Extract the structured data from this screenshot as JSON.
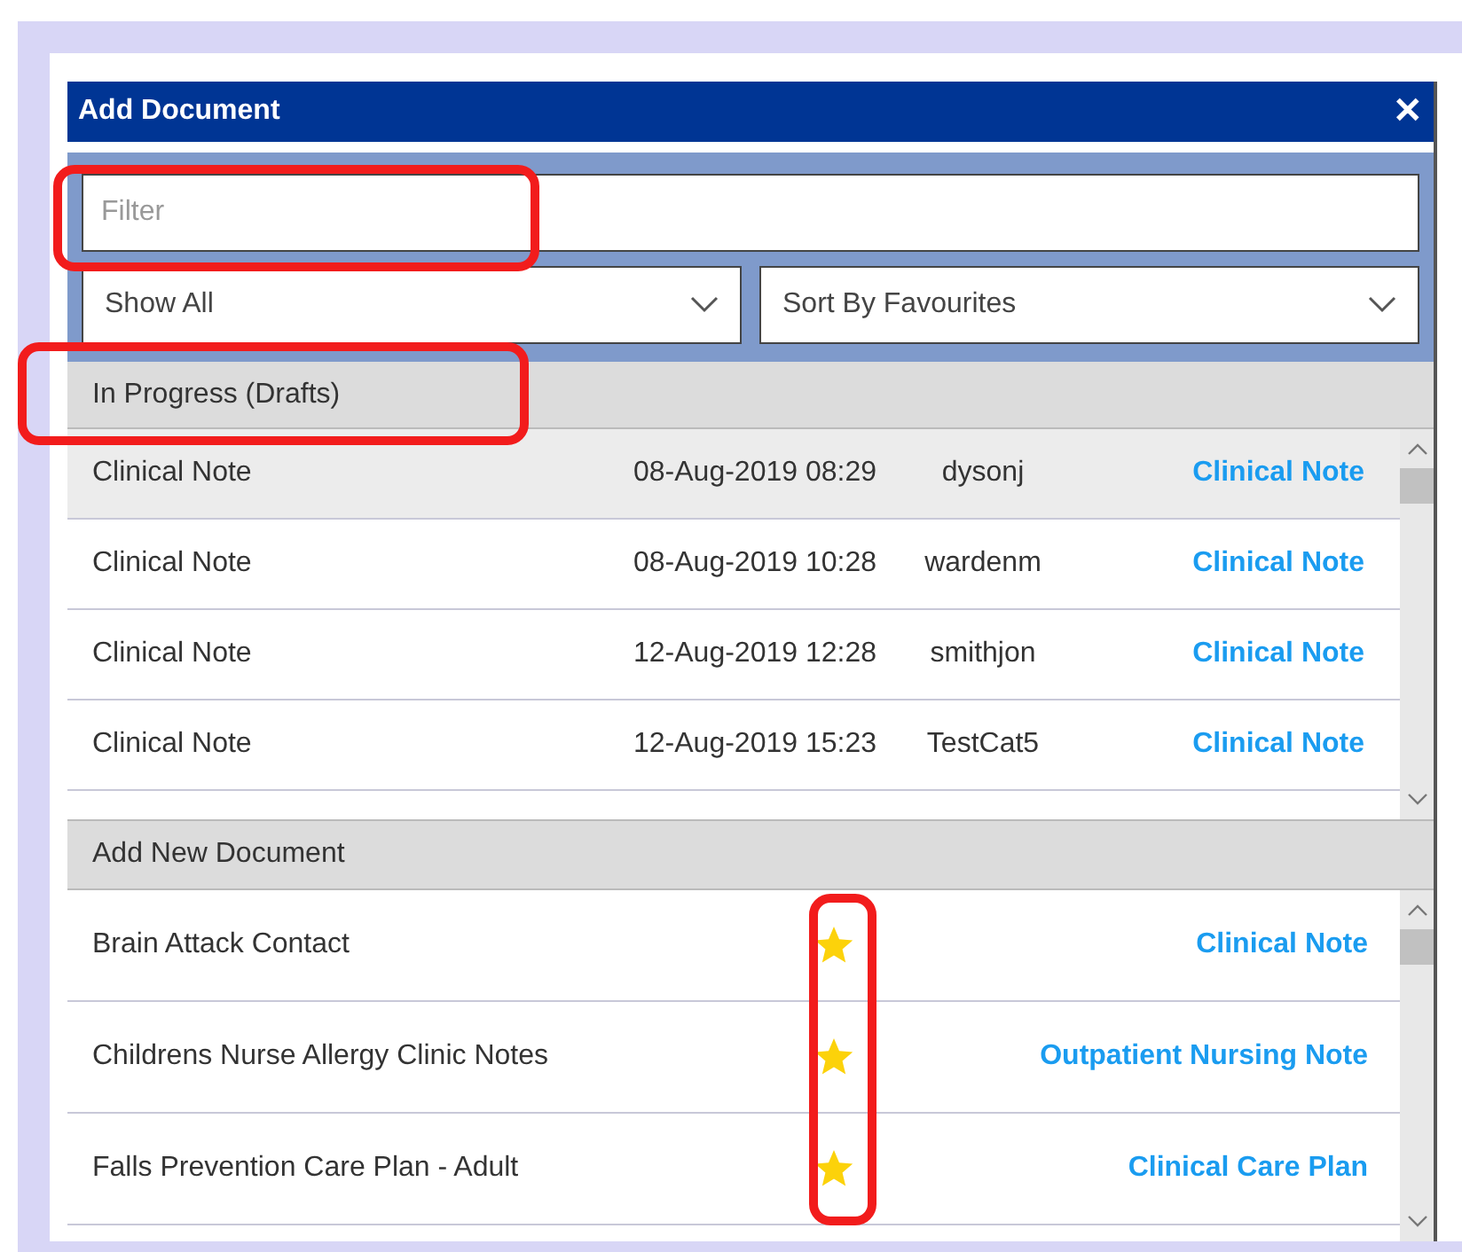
{
  "dialog": {
    "title": "Add Document",
    "close": "✕"
  },
  "filter": {
    "placeholder": "Filter",
    "highlighted": true
  },
  "dropdowns": [
    {
      "value": "Show All"
    },
    {
      "value": "Sort By Favourites"
    }
  ],
  "drafts": {
    "heading": "In Progress (Drafts)",
    "highlighted": true,
    "rows": [
      {
        "name": "Clinical Note",
        "date": "08-Aug-2019 08:29",
        "user": "dysonj",
        "type": "Clinical Note",
        "selected": true
      },
      {
        "name": "Clinical Note",
        "date": "08-Aug-2019 10:28",
        "user": "wardenm",
        "type": "Clinical Note",
        "selected": false
      },
      {
        "name": "Clinical Note",
        "date": "12-Aug-2019 12:28",
        "user": "smithjon",
        "type": "Clinical Note",
        "selected": false
      },
      {
        "name": "Clinical Note",
        "date": "12-Aug-2019 15:23",
        "user": "TestCat5",
        "type": "Clinical Note",
        "selected": false
      }
    ]
  },
  "new_documents": {
    "heading": "Add New Document",
    "favourites_highlighted": true,
    "rows": [
      {
        "name": "Brain Attack Contact",
        "favourite": true,
        "type": "Clinical Note"
      },
      {
        "name": "Childrens Nurse Allergy Clinic Notes",
        "favourite": true,
        "type": "Outpatient Nursing Note"
      },
      {
        "name": "Falls Prevention Care Plan - Adult",
        "favourite": true,
        "type": "Clinical Care Plan"
      }
    ]
  }
}
